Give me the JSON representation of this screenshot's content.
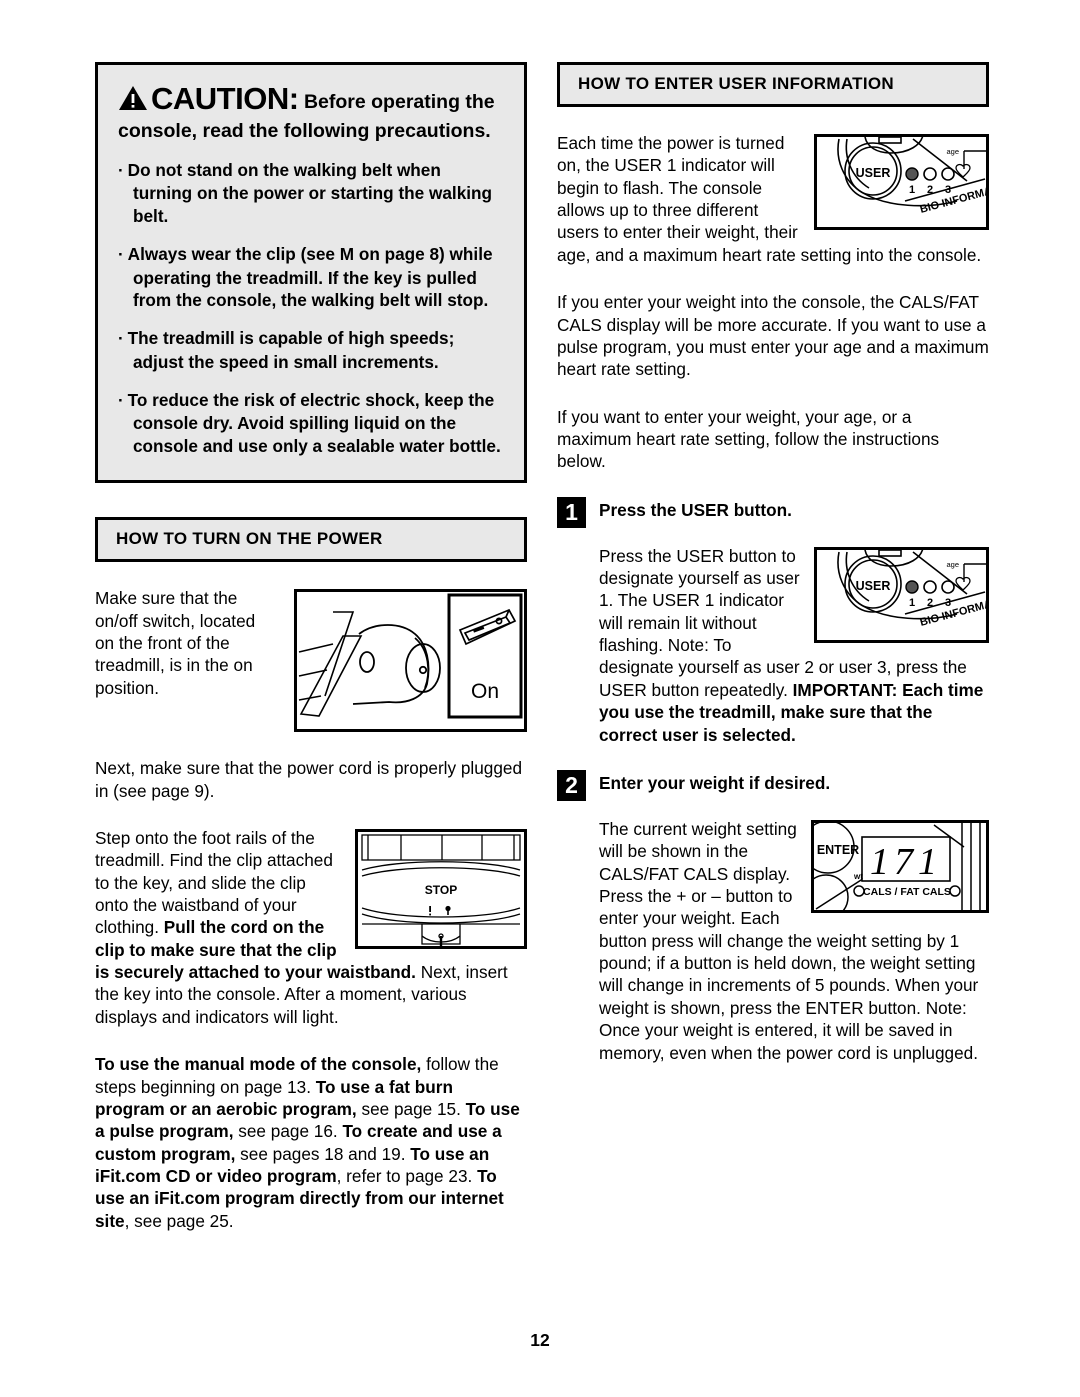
{
  "page": {
    "number": "12"
  },
  "left_column": {
    "caution": {
      "icon": "warning-triangle-icon",
      "word": "CAUTION",
      "colon": ":",
      "lead": " Before operating the console, read the following precautions.",
      "bullets": [
        "Do not stand on the walking belt when turning on the power or starting the walking belt.",
        "Always wear the clip (see M on page 8) while operating the treadmill. If the key is pulled from the console, the walking belt will stop.",
        "The treadmill is capable of high speeds; adjust the speed in small increments.",
        "To reduce the risk of electric shock, keep the console dry. Avoid spilling liquid on the console and use only a sealable water bottle."
      ]
    },
    "power_section": {
      "heading": "HOW TO TURN ON THE POWER",
      "para1": "Make sure that the on/off switch, located on the front of the treadmill, is in the on position.",
      "figure1": {
        "name": "treadmill-switch-figure",
        "callout_label": "On"
      },
      "para2": "Next, make sure that the power cord is properly plugged in (see page 9).",
      "para3_a": "Step onto the foot rails of the treadmill. Find the clip attached to the key, and slide the clip onto the waistband of your clothing. ",
      "para3_b": "Pull the cord on the clip to make sure that the clip is securely attached to your waistband.",
      "para3_c": " Next, insert the key into the console. After a moment, various displays and indicators will light.",
      "figure2": {
        "name": "console-stop-key-figure",
        "stop_label": "STOP"
      },
      "para4": [
        {
          "text": "To use the manual mode of the console,",
          "bold": true
        },
        {
          "text": " follow the steps beginning on page 13. ",
          "bold": false
        },
        {
          "text": "To use a fat burn program or an aerobic program,",
          "bold": true
        },
        {
          "text": " see page 15. ",
          "bold": false
        },
        {
          "text": "To use a pulse program,",
          "bold": true
        },
        {
          "text": " see page 16. ",
          "bold": false
        },
        {
          "text": "To create and use a custom program,",
          "bold": true
        },
        {
          "text": " see pages 18 and 19. ",
          "bold": false
        },
        {
          "text": "To use an iFit.com CD or video program",
          "bold": true
        },
        {
          "text": ", refer to page 23. ",
          "bold": false
        },
        {
          "text": "To use an iFit.com program directly from our internet site",
          "bold": true
        },
        {
          "text": ", see page 25.",
          "bold": false
        }
      ]
    }
  },
  "right_column": {
    "user_info_section": {
      "heading": "HOW TO ENTER USER INFORMATION",
      "para1": "Each time the power is turned on, the USER 1 indicator will begin to flash. The console allows up to three different users to enter their weight, their age, and a maximum heart rate setting into the console.",
      "figure1": {
        "name": "user-indicator-figure",
        "user_label": "USER",
        "indicators": [
          "1",
          "2",
          "3"
        ],
        "age_label": "age",
        "bio_label": "BIO INFORMAT",
        "heart_icon": "heart-icon"
      },
      "para2": "If you enter your weight into the console, the CALS/FAT CALS display will be more accurate. If you want to use a pulse program, you must enter your age and a maximum heart rate setting.",
      "para3": "If you want to enter your weight, your age, or a maximum heart rate setting, follow the instructions below."
    },
    "steps": [
      {
        "number": "1",
        "title": "Press the USER button.",
        "body_a": "Press the USER button to designate yourself as user 1. The USER 1 indicator will remain lit without flashing. Note: To designate yourself as user 2 or user 3, press the USER button repeatedly. ",
        "body_b": "IMPORTANT: Each time you use the treadmill, make sure that the correct user is selected.",
        "figure": {
          "name": "user-indicator-figure",
          "user_label": "USER",
          "indicators": [
            "1",
            "2",
            "3"
          ],
          "age_label": "age",
          "bio_label": "BIO INFORMAT",
          "heart_icon": "heart-icon"
        }
      },
      {
        "number": "2",
        "title": "Enter your weight if desired.",
        "body_a": "The current weight setting will be shown in the CALS/FAT CALS display. Press the + or – button to enter your weight. Each button press will change the weight setting by 1 pound; if a button is held down, the weight setting will change in increments of 5 pounds. When your weight is shown, press the ENTER button. Note: Once your weight is entered, it will be saved in memory, even when the power cord is unplugged.",
        "figure": {
          "name": "cals-display-figure",
          "enter_label": "ENTER",
          "wt_label": "wt",
          "display_value": "171",
          "cals_label": "CALS  /  FAT CALS"
        }
      }
    ]
  },
  "colors": {
    "bar_fill": "#e8e8e8",
    "border": "#000000",
    "text": "#000000",
    "page_background": "#ffffff"
  }
}
